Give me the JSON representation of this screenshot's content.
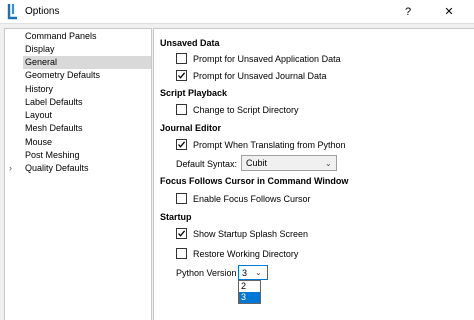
{
  "window": {
    "title": "Options",
    "help_glyph": "?",
    "close_glyph": "✕"
  },
  "nav": {
    "items": [
      {
        "label": "Command Panels"
      },
      {
        "label": "Display"
      },
      {
        "label": "General",
        "selected": true
      },
      {
        "label": "Geometry Defaults"
      },
      {
        "label": "History"
      },
      {
        "label": "Label Defaults"
      },
      {
        "label": "Layout"
      },
      {
        "label": "Mesh Defaults"
      },
      {
        "label": "Mouse"
      },
      {
        "label": "Post Meshing"
      },
      {
        "label": "Quality Defaults",
        "expandable": true
      }
    ],
    "chevron": "›"
  },
  "sections": {
    "unsaved": {
      "heading": "Unsaved Data",
      "prompt_app": {
        "label": "Prompt for Unsaved Application Data",
        "checked": false
      },
      "prompt_journal": {
        "label": "Prompt for Unsaved Journal Data",
        "checked": true
      }
    },
    "script": {
      "heading": "Script Playback",
      "change_dir": {
        "label": "Change to Script Directory",
        "checked": false
      }
    },
    "journal": {
      "heading": "Journal Editor",
      "prompt_python": {
        "label": "Prompt When Translating from Python",
        "checked": true
      },
      "syntax_label": "Default Syntax:",
      "syntax_value": "Cubit",
      "syntax_arrow": "⌄"
    },
    "focus": {
      "heading": "Focus Follows Cursor in Command Window",
      "enable": {
        "label": "Enable Focus Follows Cursor",
        "checked": false
      }
    },
    "startup": {
      "heading": "Startup",
      "splash": {
        "label": "Show Startup Splash Screen",
        "checked": true
      },
      "restore": {
        "label": "Restore Working Directory",
        "checked": false
      },
      "python_label": "Python Version",
      "python_value": "3",
      "python_arrow": "⌄",
      "python_options": [
        "2",
        "3"
      ],
      "python_selected": "3"
    }
  },
  "colors": {
    "accent": "#0078d7",
    "selection": "#d9d9d9"
  }
}
